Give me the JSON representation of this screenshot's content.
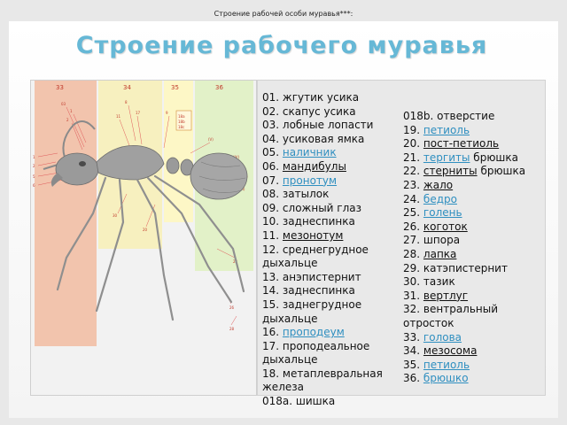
{
  "small_caption": "Строение рабочей особи муравья***:",
  "title": "Строение рабочего муравья",
  "figure": {
    "panel_labels": [
      "33",
      "34",
      "35",
      "36"
    ],
    "inset_labels": [
      "18a",
      "18b",
      "18c"
    ]
  },
  "legend_col1": [
    {
      "num": "01.",
      "term": "жгутик усика",
      "style": "plain"
    },
    {
      "num": "02.",
      "term": "скапус усика",
      "style": "plain"
    },
    {
      "num": "03.",
      "term": "лобные лопасти",
      "style": "plain"
    },
    {
      "num": "04.",
      "term": "усиковая ямка",
      "style": "plain"
    },
    {
      "num": "05.",
      "term": "наличник",
      "style": "link"
    },
    {
      "num": "06.",
      "term": "мандибулы",
      "style": "underline"
    },
    {
      "num": "07.",
      "term": "пронотум",
      "style": "link"
    },
    {
      "num": "08.",
      "term": "затылок",
      "style": "plain"
    },
    {
      "num": "09.",
      "term": "сложный глаз",
      "style": "plain"
    },
    {
      "num": "10.",
      "term": "заднеспинка",
      "style": "plain"
    },
    {
      "num": "11.",
      "term": "мезонотум",
      "style": "underline"
    },
    {
      "num": "12.",
      "term": "среднегрудное дыхальце",
      "style": "plain"
    },
    {
      "num": "13.",
      "term": "анэпистернит",
      "style": "plain"
    },
    {
      "num": "14.",
      "term": "заднеспинка",
      "style": "plain"
    },
    {
      "num": "15.",
      "term": "заднегрудное дыхальце",
      "style": "plain"
    },
    {
      "num": "16.",
      "term": "проподеум",
      "style": "link"
    },
    {
      "num": "17.",
      "term": "проподеальное дыхальце",
      "style": "plain"
    },
    {
      "num": "18.",
      "term": "метаплевральная железа",
      "style": "plain"
    },
    {
      "num": "018a.",
      "term": "шишка",
      "style": "plain"
    }
  ],
  "legend_col2": [
    {
      "num": "018b.",
      "term": "отверстие",
      "suffix": "",
      "style": "plain"
    },
    {
      "num": "19.",
      "term": "петиоль",
      "suffix": "",
      "style": "link"
    },
    {
      "num": "20.",
      "term": "пост-петиоль",
      "suffix": "",
      "style": "underline"
    },
    {
      "num": "21.",
      "term": "тергиты",
      "suffix": " брюшка",
      "style": "link"
    },
    {
      "num": "22.",
      "term": "стерниты",
      "suffix": " брюшка",
      "style": "underline"
    },
    {
      "num": "23.",
      "term": "жало",
      "suffix": "",
      "style": "underline"
    },
    {
      "num": "24.",
      "term": "бедро",
      "suffix": "",
      "style": "link"
    },
    {
      "num": "25.",
      "term": "голень",
      "suffix": "",
      "style": "link"
    },
    {
      "num": "26.",
      "term": "коготок",
      "suffix": "",
      "style": "underline"
    },
    {
      "num": "27.",
      "term": "шпора",
      "suffix": "",
      "style": "plain"
    },
    {
      "num": "28.",
      "term": "лапка",
      "suffix": "",
      "style": "underline"
    },
    {
      "num": "29.",
      "term": "катэпистернит",
      "suffix": "",
      "style": "plain"
    },
    {
      "num": "30.",
      "term": "тазик",
      "suffix": "",
      "style": "plain"
    },
    {
      "num": "31.",
      "term": "вертлуг",
      "suffix": "",
      "style": "underline"
    },
    {
      "num": "32.",
      "term": "вентральный отросток",
      "suffix": "",
      "style": "plain"
    },
    {
      "num": "33.",
      "term": "голова",
      "suffix": "",
      "style": "link"
    },
    {
      "num": "34.",
      "term": "мезосома",
      "suffix": "",
      "style": "underline"
    },
    {
      "num": "35.",
      "term": "петиоль",
      "suffix": "",
      "style": "link"
    },
    {
      "num": "36.",
      "term": "брюшко",
      "suffix": "",
      "style": "link"
    }
  ],
  "colors": {
    "title": "#66b8d6",
    "link": "#2f8fc0",
    "head_band": "#f2c4ad",
    "mesosoma_band": "#f7f0bf",
    "petiole_band": "#fdf7c6",
    "gaster_band": "#e2f1c8",
    "ant_body": "#8a8a8a",
    "leader_line": "#e05a5a"
  }
}
